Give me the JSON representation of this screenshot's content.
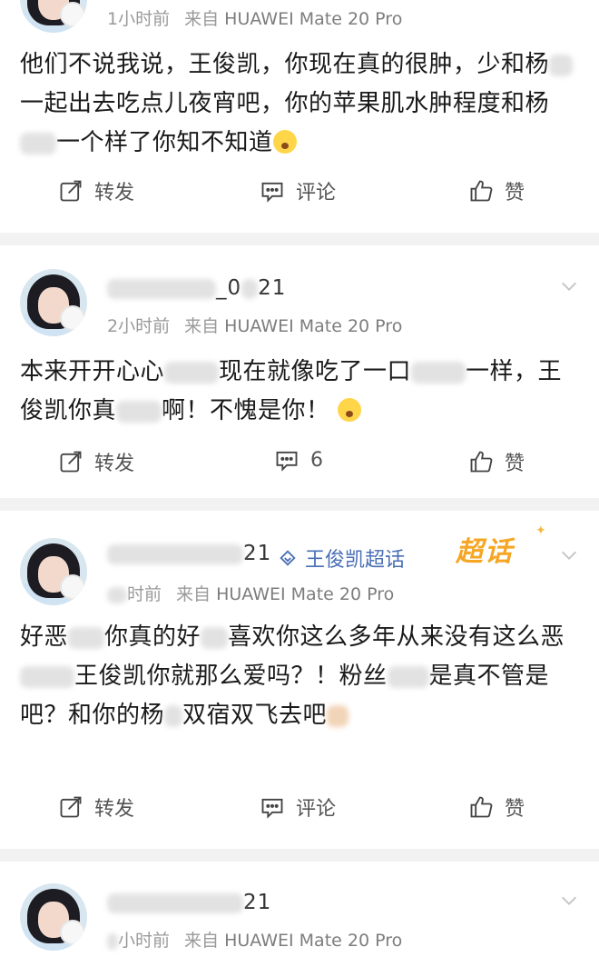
{
  "posts": [
    {
      "time": "1小时前",
      "source_prefix": "来自",
      "device": "HUAWEI Mate 20 Pro",
      "body_parts": [
        "他们不说我说，王俊凯，你现在真的很肿，少和杨",
        "一起出去吃点儿夜宵吧，你的苹果肌水肿程度和杨",
        "一个样了你知不知道"
      ],
      "actions": {
        "repost": "转发",
        "comment": "评论",
        "like": "赞"
      }
    },
    {
      "username_visible_end": "_0",
      "username_tail": "21",
      "time": "2小时前",
      "source_prefix": "来自",
      "device": "HUAWEI Mate 20 Pro",
      "body_parts": [
        "本来开开心心",
        "现在就像吃了一口",
        "一样，王俊凯你真",
        "啊！不愧是你！"
      ],
      "actions": {
        "repost": "转发",
        "comment": "6",
        "like": "赞"
      }
    },
    {
      "username_tail": "21",
      "topic": "王俊凯超话",
      "badge": "超话",
      "time": "时前",
      "source_prefix": "来自",
      "device": "HUAWEI Mate 20 Pro",
      "body_parts": [
        "好恶",
        "你真的好",
        "喜欢你这么多年从来没有这么恶",
        "王俊凯你就那么爱吗？！粉丝",
        "是真不管是吧？和你的杨",
        "双宿双飞去吧"
      ],
      "actions": {
        "repost": "转发",
        "comment": "评论",
        "like": "赞"
      }
    },
    {
      "username_tail": "21",
      "time": "小时前",
      "source_prefix": "来自",
      "device": "HUAWEI Mate 20 Pro"
    }
  ],
  "icons": [
    "repost-icon",
    "comment-icon",
    "like-icon",
    "chevron-down-icon",
    "topic-diamond-icon"
  ],
  "colors": {
    "topic": "#4a6fb5",
    "badge": "#f5a623",
    "meta": "#9a9a9a",
    "divider": "#f2f2f2"
  }
}
